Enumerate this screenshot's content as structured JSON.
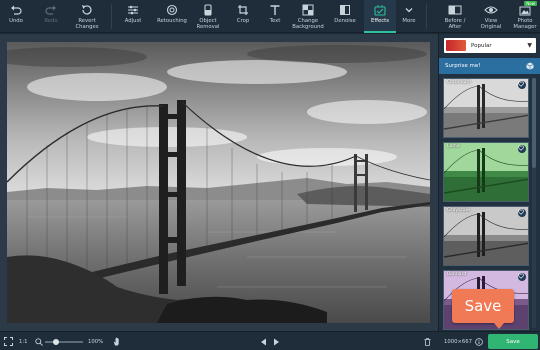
{
  "toolbar": {
    "undo": "Undo",
    "redo": "Redo",
    "revert": "Revert Changes",
    "adjust": "Adjust",
    "retouching": "Retouching",
    "object_removal": "Object Removal",
    "crop": "Crop",
    "text": "Text",
    "change_background": "Change Background",
    "denoise": "Denoise",
    "effects": "Effects",
    "more": "More",
    "before_after": "Before / After",
    "view_original": "View Original",
    "photo_manager": "Photo Manager",
    "new_badge": "New",
    "active_tool": "Effects"
  },
  "panel": {
    "category": "Popular",
    "surprise": "Surprise me!",
    "thumbnails": [
      {
        "label": "Chromium"
      },
      {
        "label": "Lomo"
      },
      {
        "label": "Grayscale"
      },
      {
        "label": "Bonnard"
      }
    ]
  },
  "tooltip": {
    "save": "Save"
  },
  "statusbar": {
    "fit": "1:1",
    "zoom": "100%",
    "dimensions": "1000×667",
    "save": "Save",
    "zoom_level": 0.3
  },
  "colors": {
    "accent": "#2fbf9a",
    "save_green": "#31b573",
    "tooltip": "#f07a55",
    "surprise_bar": "#2a6fa0"
  }
}
